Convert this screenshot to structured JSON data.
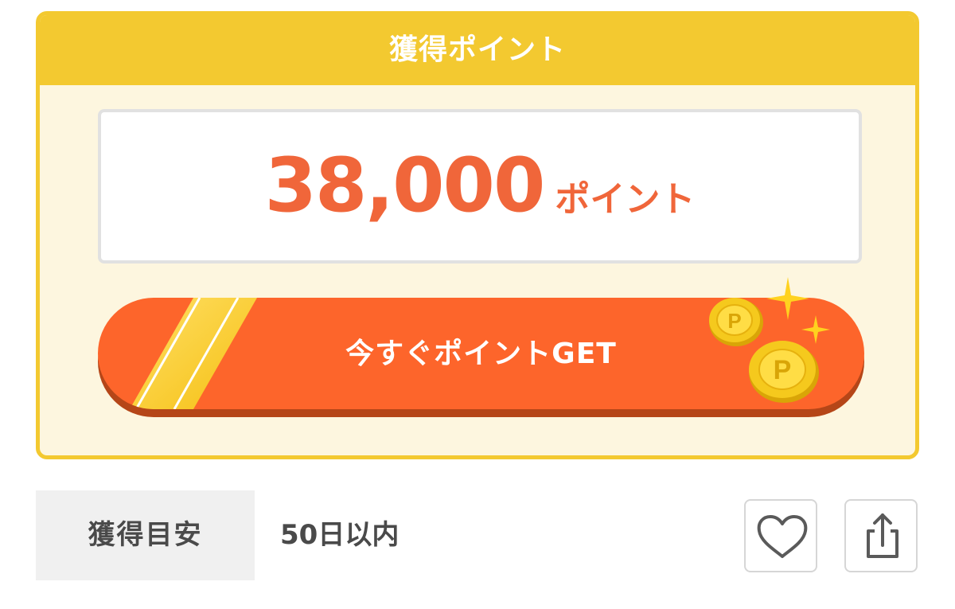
{
  "card": {
    "title": "獲得ポイント",
    "points_value": "38,000",
    "points_unit": "ポイント"
  },
  "cta": {
    "label": "今すぐポイントGET",
    "coin_letter": "P"
  },
  "estimate": {
    "label": "獲得目安",
    "value": "50日以内"
  },
  "icons": {
    "favorite": "heart-icon",
    "share": "share-icon"
  },
  "colors": {
    "header_yellow": "#f3c930",
    "card_bg": "#fdf6df",
    "accent_orange": "#f0663a",
    "button_orange": "#fd652b",
    "button_shadow": "#b54618",
    "coin_gold": "#f2c521"
  }
}
